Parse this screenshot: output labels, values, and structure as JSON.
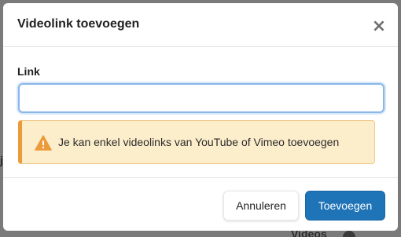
{
  "background": {
    "hint_left": "j",
    "hint_bottom": "Videos"
  },
  "dialog": {
    "title": "Videolink toevoegen",
    "close_label": "×",
    "field": {
      "label": "Link",
      "value": "",
      "placeholder": ""
    },
    "alert": {
      "icon": "warning-icon",
      "text": "Je kan enkel videolinks van YouTube of Vimeo toevoegen"
    },
    "buttons": {
      "cancel_label": "Annuleren",
      "submit_label": "Toevoegen"
    }
  },
  "colors": {
    "primary": "#1f73b7",
    "warning_bg": "#fdeecb",
    "warning_border": "#ec9a3a",
    "input_focus": "#8ab6e8"
  }
}
